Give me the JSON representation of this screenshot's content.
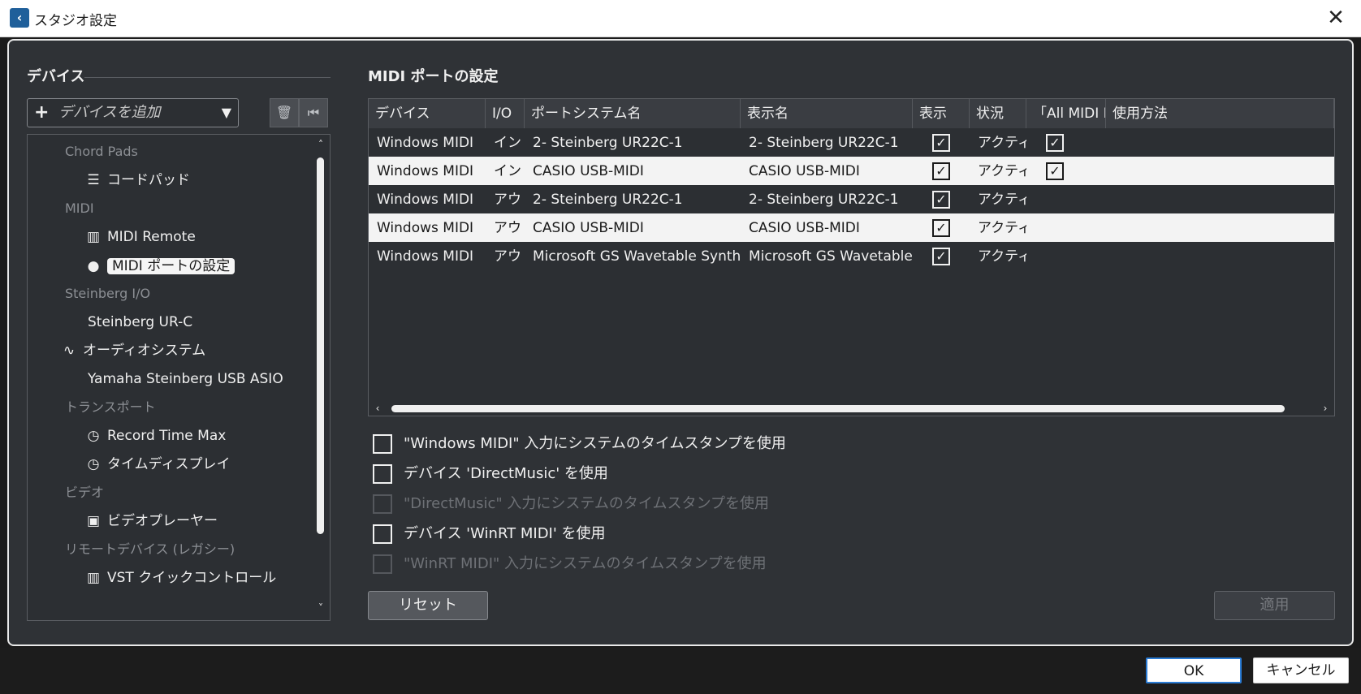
{
  "window": {
    "title": "スタジオ設定",
    "close_glyph": "✕"
  },
  "left": {
    "section_title": "デバイス",
    "add_device_placeholder": "デバイスを追加",
    "tree": [
      {
        "type": "category",
        "label": "Chord Pads"
      },
      {
        "type": "item",
        "label": "コードパッド",
        "icon": "chord-pads-icon",
        "glyph": "☰"
      },
      {
        "type": "category",
        "label": "MIDI"
      },
      {
        "type": "item",
        "label": "MIDI Remote",
        "icon": "midi-remote-icon",
        "glyph": "▥"
      },
      {
        "type": "item",
        "label": "MIDI ポートの設定",
        "icon": "midi-port-icon",
        "glyph": "●",
        "selected": true
      },
      {
        "type": "category",
        "label": "Steinberg I/O"
      },
      {
        "type": "item",
        "label": "Steinberg UR-C",
        "icon": "",
        "glyph": ""
      },
      {
        "type": "item",
        "label": "オーディオシステム",
        "icon": "audio-waveform-icon",
        "glyph": "∿"
      },
      {
        "type": "item",
        "label": "Yamaha Steinberg USB ASIO",
        "icon": "",
        "glyph": ""
      },
      {
        "type": "category",
        "label": "トランスポート"
      },
      {
        "type": "item",
        "label": "Record Time Max",
        "icon": "clock-icon",
        "glyph": "◷"
      },
      {
        "type": "item",
        "label": "タイムディスプレイ",
        "icon": "clock-icon",
        "glyph": "◷"
      },
      {
        "type": "category",
        "label": "ビデオ"
      },
      {
        "type": "item",
        "label": "ビデオプレーヤー",
        "icon": "film-icon",
        "glyph": "▣"
      },
      {
        "type": "category",
        "label": "リモートデバイス (レガシー)"
      },
      {
        "type": "item",
        "label": "VST クイックコントロール",
        "icon": "midi-remote-icon",
        "glyph": "▥"
      }
    ]
  },
  "right": {
    "section_title": "MIDI ポートの設定",
    "columns": [
      "デバイス",
      "I/O",
      "ポートシステム名",
      "表示名",
      "表示",
      "状況",
      "「All MIDI I",
      "使用方法"
    ],
    "rows": [
      {
        "device": "Windows MIDI",
        "io": "イン",
        "system_name": "2- Steinberg UR22C-1",
        "display_name": "2- Steinberg UR22C-1",
        "show": "✓",
        "status": "アクティブ",
        "all_midi": "✓",
        "usage": ""
      },
      {
        "device": "Windows MIDI",
        "io": "イン",
        "system_name": "CASIO USB-MIDI",
        "display_name": "CASIO USB-MIDI",
        "show": "✓",
        "status": "アクティブ",
        "all_midi": "✓",
        "usage": ""
      },
      {
        "device": "Windows MIDI",
        "io": "アウト",
        "system_name": "2- Steinberg UR22C-1",
        "display_name": "2- Steinberg UR22C-1",
        "show": "✓",
        "status": "アクティブ",
        "all_midi": "",
        "usage": ""
      },
      {
        "device": "Windows MIDI",
        "io": "アウト",
        "system_name": "CASIO USB-MIDI",
        "display_name": "CASIO USB-MIDI",
        "show": "✓",
        "status": "アクティブ",
        "all_midi": "",
        "usage": ""
      },
      {
        "device": "Windows MIDI",
        "io": "アウト",
        "system_name": "Microsoft GS Wavetable Synth",
        "display_name": "Microsoft GS Wavetable Synth",
        "show": "✓",
        "status": "アクティブ",
        "all_midi": "",
        "usage": ""
      }
    ],
    "options": [
      {
        "label": "\"Windows MIDI\" 入力にシステムのタイムスタンプを使用",
        "enabled": true
      },
      {
        "label": "デバイス 'DirectMusic' を使用",
        "enabled": true
      },
      {
        "label": "\"DirectMusic\" 入力にシステムのタイムスタンプを使用",
        "enabled": false
      },
      {
        "label": "デバイス 'WinRT MIDI' を使用",
        "enabled": true
      },
      {
        "label": "\"WinRT MIDI\" 入力にシステムのタイムスタンプを使用",
        "enabled": false
      }
    ],
    "reset_label": "リセット",
    "apply_label": "適用"
  },
  "footer": {
    "ok_label": "OK",
    "cancel_label": "キャンセル"
  },
  "colors": {
    "background": "#2f3236",
    "accent": "#2a7bd4",
    "row_light": "#f3f3f3"
  }
}
